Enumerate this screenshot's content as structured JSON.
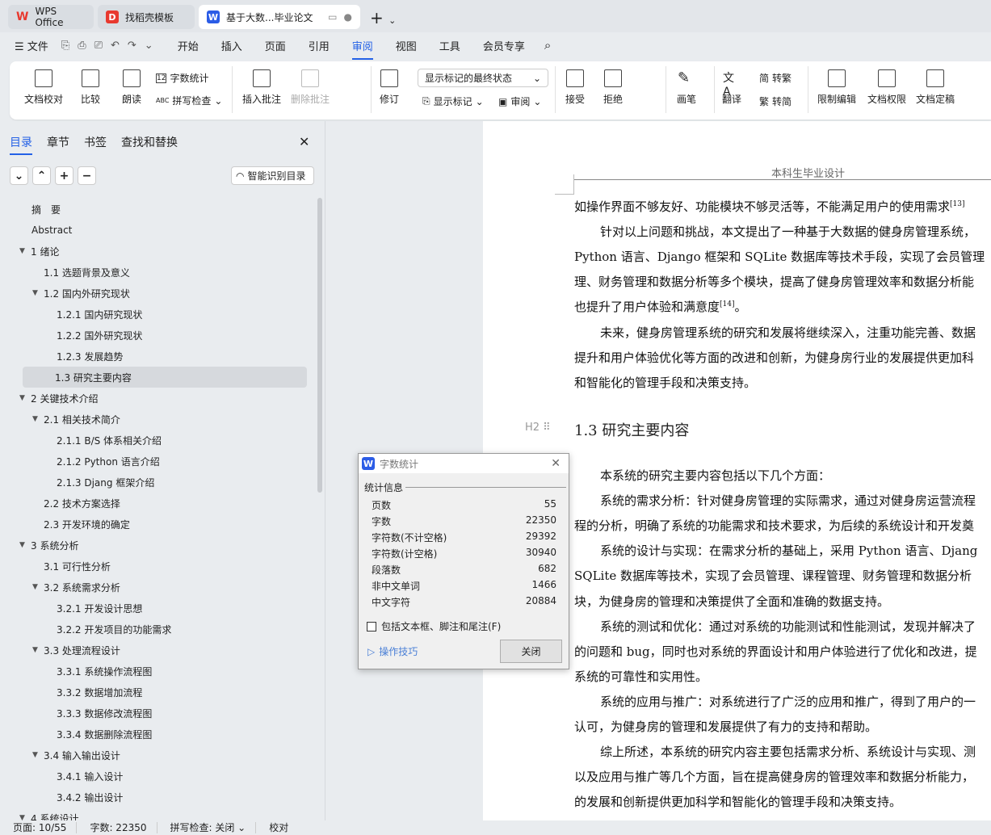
{
  "tabs": [
    {
      "label": "WPS Office",
      "icon": "wps-logo-icon"
    },
    {
      "label": "找稻壳模板",
      "icon": "docer-icon"
    },
    {
      "label": "基于大数...毕业论文",
      "icon": "word-doc-icon"
    }
  ],
  "menu": {
    "file": "文件",
    "items": [
      "开始",
      "插入",
      "页面",
      "引用",
      "审阅",
      "视图",
      "工具",
      "会员专享"
    ],
    "active": "审阅"
  },
  "ribbon": {
    "proofread": "文档校对",
    "compare": "比较",
    "read_aloud": "朗读",
    "word_count": "字数统计",
    "spell_check": "拼写检查",
    "insert_comment": "插入批注",
    "delete_comment": "删除批注",
    "track_changes": "修订",
    "markup_select": "显示标记的最终状态",
    "show_markup": "显示标记",
    "review_pane": "审阅",
    "accept": "接受",
    "reject": "拒绝",
    "pen": "画笔",
    "translate": "翻译",
    "to_traditional": "转繁",
    "to_simplified": "转简",
    "restrict_edit": "限制编辑",
    "doc_permission": "文档权限",
    "finalize": "文档定稿"
  },
  "sidebar": {
    "tabs": [
      "目录",
      "章节",
      "书签",
      "查找和替换"
    ],
    "active": "目录",
    "smart_toc": "智能识别目录",
    "toc": [
      {
        "label": "摘　要",
        "level": 0,
        "arrow": false
      },
      {
        "label": "Abstract",
        "level": 0,
        "arrow": false
      },
      {
        "label": "1  绪论",
        "level": 0,
        "arrow": true
      },
      {
        "label": "1.1 选题背景及意义",
        "level": 1,
        "arrow": false
      },
      {
        "label": "1.2 国内外研究现状",
        "level": 1,
        "arrow": true
      },
      {
        "label": "1.2.1 国内研究现状",
        "level": 2,
        "arrow": false
      },
      {
        "label": "1.2.2 国外研究现状",
        "level": 2,
        "arrow": false
      },
      {
        "label": "1.2.3 发展趋势",
        "level": 2,
        "arrow": false
      },
      {
        "label": "1.3 研究主要内容",
        "level": 1,
        "arrow": false,
        "selected": true
      },
      {
        "label": "2  关键技术介绍",
        "level": 0,
        "arrow": true
      },
      {
        "label": "2.1 相关技术简介",
        "level": 1,
        "arrow": true
      },
      {
        "label": "2.1.1 B/S 体系相关介绍",
        "level": 2,
        "arrow": false
      },
      {
        "label": "2.1.2 Python 语言介绍",
        "level": 2,
        "arrow": false
      },
      {
        "label": "2.1.3 Djang 框架介绍",
        "level": 2,
        "arrow": false
      },
      {
        "label": "2.2 技术方案选择",
        "level": 1,
        "arrow": false
      },
      {
        "label": "2.3 开发环境的确定",
        "level": 1,
        "arrow": false
      },
      {
        "label": "3  系统分析",
        "level": 0,
        "arrow": true
      },
      {
        "label": "3.1 可行性分析",
        "level": 1,
        "arrow": false
      },
      {
        "label": "3.2  系统需求分析",
        "level": 1,
        "arrow": true
      },
      {
        "label": "3.2.1  开发设计思想",
        "level": 2,
        "arrow": false
      },
      {
        "label": "3.2.2  开发项目的功能需求",
        "level": 2,
        "arrow": false
      },
      {
        "label": "3.3 处理流程设计",
        "level": 1,
        "arrow": true
      },
      {
        "label": "3.3.1 系统操作流程图",
        "level": 2,
        "arrow": false
      },
      {
        "label": "3.3.2 数据增加流程",
        "level": 2,
        "arrow": false
      },
      {
        "label": "3.3.3 数据修改流程图",
        "level": 2,
        "arrow": false
      },
      {
        "label": "3.3.4 数据删除流程图",
        "level": 2,
        "arrow": false
      },
      {
        "label": "3.4 输入输出设计",
        "level": 1,
        "arrow": true
      },
      {
        "label": "3.4.1 输入设计",
        "level": 2,
        "arrow": false
      },
      {
        "label": "3.4.2 输出设计",
        "level": 2,
        "arrow": false
      },
      {
        "label": "4  系统设计",
        "level": 0,
        "arrow": true
      }
    ]
  },
  "document": {
    "header": "本科生毕业设计",
    "heading": "1.3 研究主要内容",
    "heading_marker": "H2",
    "para1": [
      {
        "text": "如操作界面不够友好、功能模块不够灵活等，不能满足用户的使用需求",
        "sup": "[13]",
        "indent": false
      },
      {
        "text": "针对以上问题和挑战，本文提出了一种基于大数据的健身房管理系统，",
        "indent": true
      },
      {
        "text": "Python 语言、Django 框架和 SQLite 数据库等技术手段，实现了会员管理",
        "indent": false
      },
      {
        "text": "理、财务管理和数据分析等多个模块，提高了健身房管理效率和数据分析能",
        "indent": false
      },
      {
        "text": "也提升了用户体验和满意度",
        "sup": "[14]",
        "tail": "。",
        "indent": false
      },
      {
        "text": "未来，健身房管理系统的研究和发展将继续深入，注重功能完善、数据",
        "indent": true
      },
      {
        "text": "提升和用户体验优化等方面的改进和创新，为健身房行业的发展提供更加科",
        "indent": false
      },
      {
        "text": "和智能化的管理手段和决策支持。",
        "indent": false
      }
    ],
    "para2": [
      {
        "text": "本系统的研究主要内容包括以下几个方面：",
        "indent": true
      },
      {
        "text": "系统的需求分析：针对健身房管理的实际需求，通过对健身房运营流程",
        "indent": true
      },
      {
        "text": "程的分析，明确了系统的功能需求和技术要求，为后续的系统设计和开发奠",
        "indent": false
      },
      {
        "text": "系统的设计与实现：在需求分析的基础上，采用 Python 语言、Djang",
        "indent": true
      },
      {
        "text": "SQLite 数据库等技术，实现了会员管理、课程管理、财务管理和数据分析",
        "indent": false
      },
      {
        "text": "块，为健身房的管理和决策提供了全面和准确的数据支持。",
        "indent": false
      },
      {
        "text": "系统的测试和优化：通过对系统的功能测试和性能测试，发现并解决了",
        "indent": true
      },
      {
        "text": "的问题和 bug，同时也对系统的界面设计和用户体验进行了优化和改进，提",
        "indent": false
      },
      {
        "text": "系统的可靠性和实用性。",
        "indent": false
      },
      {
        "text": "系统的应用与推广：对系统进行了广泛的应用和推广，得到了用户的一",
        "indent": true
      },
      {
        "text": "认可，为健身房的管理和发展提供了有力的支持和帮助。",
        "indent": false
      },
      {
        "text": "综上所述，本系统的研究内容主要包括需求分析、系统设计与实现、测",
        "indent": true
      },
      {
        "text": "以及应用与推广等几个方面，旨在提高健身房的管理效率和数据分析能力，",
        "indent": false
      },
      {
        "text": "的发展和创新提供更加科学和智能化的管理手段和决策支持。",
        "indent": false
      }
    ]
  },
  "dialog": {
    "title": "字数统计",
    "section": "统计信息",
    "rows": [
      {
        "label": "页数",
        "value": "55"
      },
      {
        "label": "字数",
        "value": "22350"
      },
      {
        "label": "字符数(不计空格)",
        "value": "29392"
      },
      {
        "label": "字符数(计空格)",
        "value": "30940"
      },
      {
        "label": "段落数",
        "value": "682"
      },
      {
        "label": "非中文单词",
        "value": "1466"
      },
      {
        "label": "中文字符",
        "value": "20884"
      }
    ],
    "checkbox": "包括文本框、脚注和尾注(F)",
    "checkbox_checked": false,
    "tips": "操作技巧",
    "close": "关闭"
  },
  "status": {
    "page": "页面: 10/55",
    "words": "字数: 22350",
    "spell": "拼写检查: 关闭",
    "proof": "校对"
  },
  "colors": {
    "accent": "#2461e6",
    "wps_red": "#e8392f",
    "word_blue": "#2b5ce6"
  }
}
